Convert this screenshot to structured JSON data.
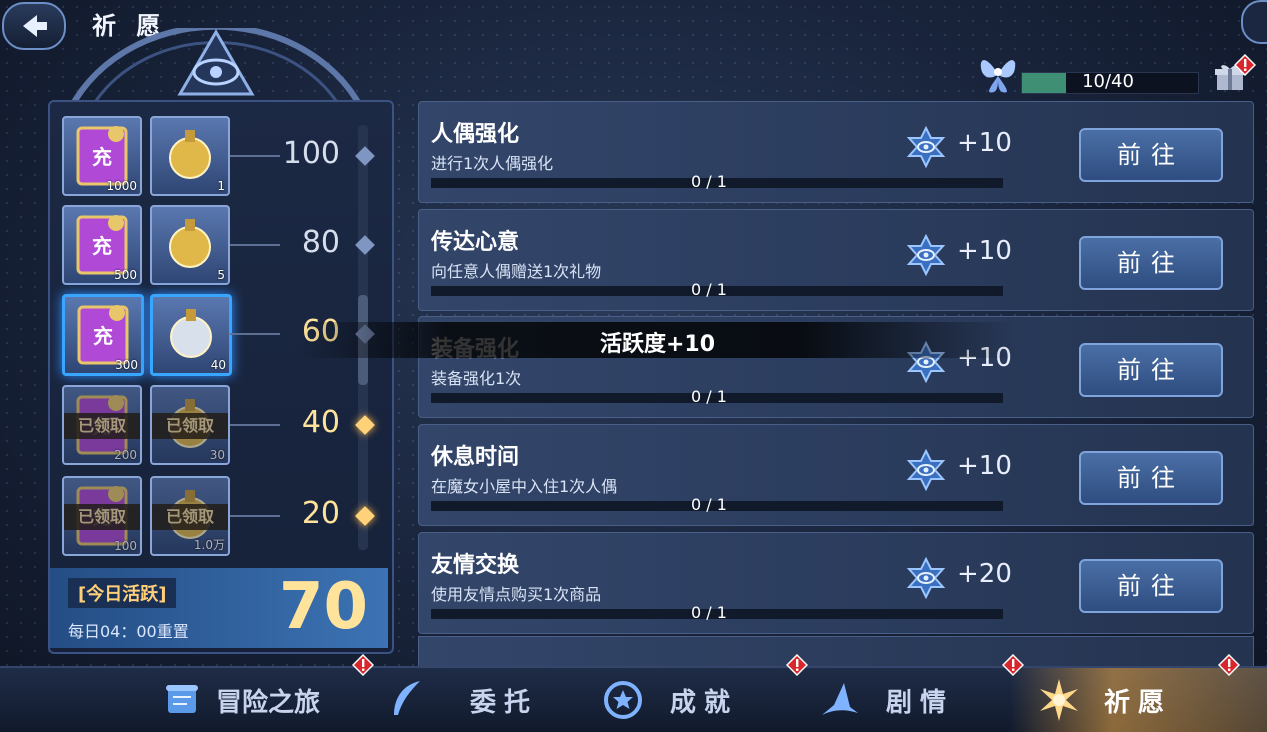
{
  "header": {
    "title": "祈 愿",
    "progress_text": "10/40",
    "progress_fraction": 0.25
  },
  "rewards": [
    {
      "milestone": "100",
      "items": [
        {
          "qty": "1000",
          "claimed": false
        },
        {
          "qty": "1",
          "claimed": false
        }
      ]
    },
    {
      "milestone": "80",
      "items": [
        {
          "qty": "500",
          "claimed": false
        },
        {
          "qty": "5",
          "claimed": false
        }
      ]
    },
    {
      "milestone": "60",
      "items": [
        {
          "qty": "300",
          "claimed": false
        },
        {
          "qty": "40",
          "claimed": false
        }
      ]
    },
    {
      "milestone": "40",
      "items": [
        {
          "qty": "200",
          "claimed": true
        },
        {
          "qty": "30",
          "claimed": true
        }
      ]
    },
    {
      "milestone": "20",
      "items": [
        {
          "qty": "100",
          "claimed": true
        },
        {
          "qty": "1.0万",
          "claimed": true
        }
      ]
    }
  ],
  "claimed_label": "已领取",
  "item_glyph": "充",
  "today": {
    "label": "[今日活跃]",
    "reset": "每日04：00重置",
    "value": "70"
  },
  "tooltip": "活跃度+10",
  "tasks": [
    {
      "title": "人偶强化",
      "desc": "进行1次人偶强化",
      "count": "0 / 1",
      "points": "+10",
      "button": "前往"
    },
    {
      "title": "传达心意",
      "desc": "向任意人偶赠送1次礼物",
      "count": "0 / 1",
      "points": "+10",
      "button": "前往"
    },
    {
      "title": "装备强化",
      "desc": "装备强化1次",
      "count": "0 / 1",
      "points": "+10",
      "button": "前往"
    },
    {
      "title": "休息时间",
      "desc": "在魔女小屋中入住1次人偶",
      "count": "0 / 1",
      "points": "+10",
      "button": "前往"
    },
    {
      "title": "友情交换",
      "desc": "使用友情点购买1次商品",
      "count": "0 / 1",
      "points": "+20",
      "button": "前往"
    }
  ],
  "nav": [
    {
      "label": "冒险之旅",
      "alert": true
    },
    {
      "label": "委托",
      "alert": true
    },
    {
      "label": "成就",
      "alert": false
    },
    {
      "label": "剧情",
      "alert": true
    },
    {
      "label": "祈愿",
      "alert": true,
      "active": true
    }
  ],
  "colors": {
    "accent": "#38a6ff",
    "gold": "#ffe39b",
    "progress": "#3e8f74",
    "alert": "#d9262c"
  }
}
